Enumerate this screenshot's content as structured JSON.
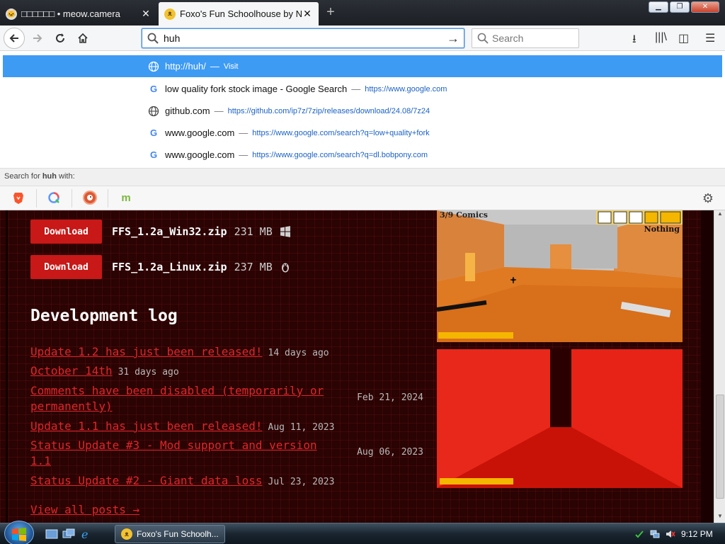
{
  "tabs": [
    {
      "title": "□□□□□□ • meow.camera",
      "icon": "cat-icon"
    },
    {
      "title": "Foxo's Fun Schoolhouse by Nick",
      "icon": "fox-icon"
    }
  ],
  "urlbar": {
    "value": "huh"
  },
  "searchbar": {
    "placeholder": "Search"
  },
  "autocomplete": [
    {
      "title": "http://huh/",
      "sep": "—",
      "url": "Visit",
      "icon": "globe-icon"
    },
    {
      "title": "low quality fork stock image - Google Search",
      "sep": "—",
      "url": "https://www.google.com",
      "icon": "google-icon"
    },
    {
      "title": "github.com",
      "sep": "—",
      "url": "https://github.com/ip7z/7zip/releases/download/24.08/7z24",
      "icon": "globe-icon"
    },
    {
      "title": "www.google.com",
      "sep": "—",
      "url": "https://www.google.com/search?q=low+quality+fork",
      "icon": "google-icon"
    },
    {
      "title": "www.google.com",
      "sep": "—",
      "url": "https://www.google.com/search?q=dl.bobpony.com",
      "icon": "google-icon"
    }
  ],
  "search_with": {
    "prefix": "Search for ",
    "query": "huh",
    "suffix": " with:"
  },
  "engines": [
    {
      "name": "brave-icon",
      "glyph": "▽",
      "color": "#fb542b"
    },
    {
      "name": "qwant-icon",
      "glyph": "Q",
      "color": "#5c97ff"
    },
    {
      "name": "duckduckgo-icon",
      "glyph": "◉",
      "color": "#de5833"
    },
    {
      "name": "mojeek-icon",
      "glyph": "m",
      "color": "#7ab93d"
    }
  ],
  "downloads": [
    {
      "button": "Download",
      "file": "FFS_1.2a_Win32.zip",
      "size": "231 MB",
      "os_icon": "windows-icon"
    },
    {
      "button": "Download",
      "file": "FFS_1.2a_Linux.zip",
      "size": "237 MB",
      "os_icon": "linux-icon"
    }
  ],
  "devlog": {
    "title": "Development log",
    "posts": [
      {
        "title": "Update 1.2 has just been released!",
        "date": "14 days ago"
      },
      {
        "title": "October 14th",
        "date": "31 days ago"
      },
      {
        "title": "Comments have been disabled (temporarily or permanently)",
        "date": "Feb 21, 2024"
      },
      {
        "title": "Update 1.1 has just been released!",
        "date": "Aug 11, 2023"
      },
      {
        "title": "Status Update #3 - Mod support and version 1.1",
        "date": "Aug 06, 2023"
      },
      {
        "title": "Status Update #2 - Giant data loss",
        "date": "Jul 23, 2023"
      }
    ],
    "view_all": "View all posts →"
  },
  "screenshot1": {
    "counter": "3/9 Comics",
    "item": "Nothing"
  },
  "taskbar": {
    "window_title": "Foxo's Fun Schoolh...",
    "clock": "9:12 PM"
  },
  "colors": {
    "accent": "#3e9bf4",
    "page_bg": "#2a0303",
    "link_red": "#e0252b",
    "button_red": "#c81818"
  }
}
